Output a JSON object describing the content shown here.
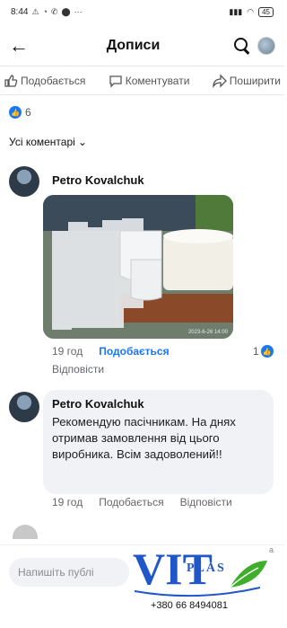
{
  "status_bar": {
    "time": "8:44",
    "battery": "45"
  },
  "header": {
    "title": "Дописи"
  },
  "actions": {
    "like": "Подобається",
    "comment": "Коментувати",
    "share": "Поширити"
  },
  "reactions": {
    "count": "6"
  },
  "filter": {
    "label": "Усі коментарі"
  },
  "comments": [
    {
      "author": "Petro Kovalchuk",
      "photo_timestamp": "2023-6-26 14:00",
      "time": "19 год",
      "like_label": "Подобається",
      "reply_label": "Відповісти",
      "like_count": "1"
    },
    {
      "author": "Petro Kovalchuk",
      "text": "Рекомендую пасічникам. На днях отримав замовлення від цього виробника. Всім задоволений!!",
      "time": "19 год",
      "like_label": "Подобається",
      "reply_label": "Відповісти"
    }
  ],
  "composer": {
    "placeholder": "Напишіть публі",
    "side_text": "а"
  },
  "logo": {
    "brand_top": "VIT",
    "brand_bottom": "PLAS",
    "phone": "+380 66 8494081"
  },
  "colors": {
    "accent": "#1877f2",
    "logo_blue": "#1f57c8",
    "logo_green": "#3fae2a"
  }
}
